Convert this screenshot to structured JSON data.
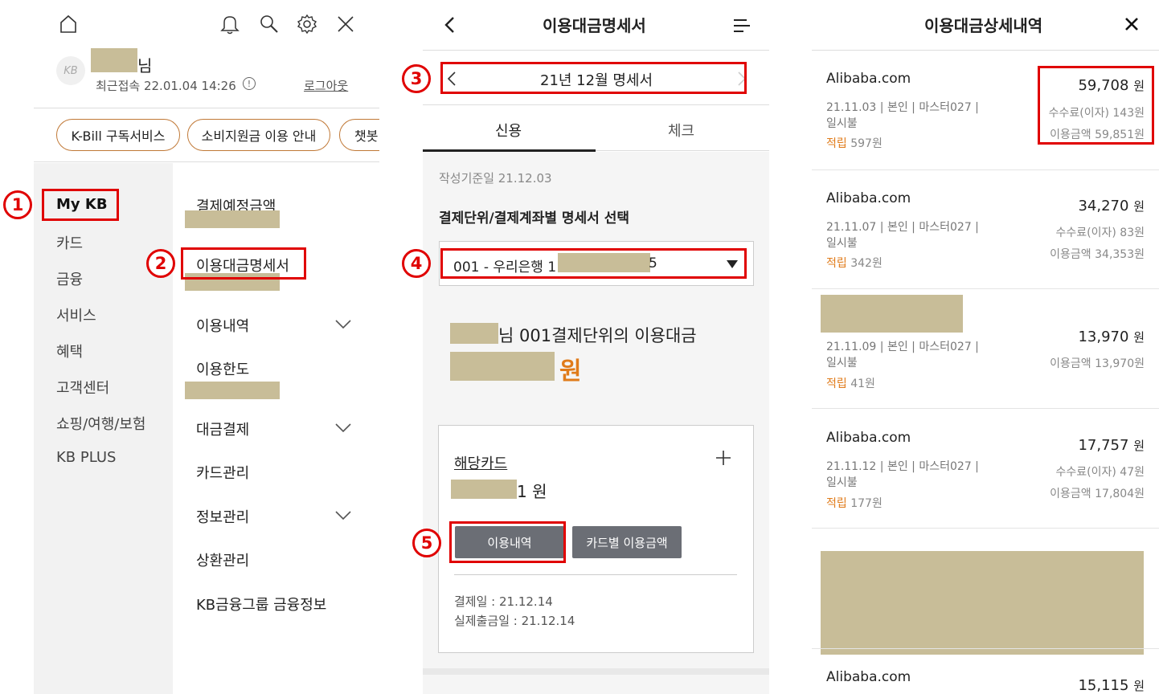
{
  "menu": {
    "user_suffix": "님",
    "last_login": "최근접속 22.01.04 14:26",
    "logout": "로그아웃",
    "chips": [
      "K-Bill 구독서비스",
      "소비지원금 이용 안내",
      "챗봇"
    ],
    "left_nav": [
      "My KB",
      "카드",
      "금융",
      "서비스",
      "혜택",
      "고객센터",
      "쇼핑/여행/보험",
      "KB PLUS"
    ],
    "sub_items": [
      "결제예정금액",
      "이용대금명세서",
      "이용내역",
      "이용한도",
      "대금결제",
      "카드관리",
      "정보관리",
      "상환관리",
      "KB금융그룹 금융정보"
    ],
    "logo_text": "KB"
  },
  "statement": {
    "title": "이용대금명세서",
    "month": "21년 12월 명세서",
    "tab_credit": "신용",
    "tab_check": "체크",
    "basis_date": "작성기준일 21.12.03",
    "select_label": "결제단위/결제계좌별 명세서 선택",
    "account_prefix": "001 - 우리은행 1",
    "account_suffix": "5",
    "billing_text": "님 001결제단위의 이용대금",
    "billing_won": "원",
    "card_link": "해당카드",
    "card_amount_suffix": "1 원",
    "btn_history": "이용내역",
    "btn_by_card": "카드별 이용금액",
    "pay_date": "결제일 : 21.12.14",
    "withdraw_date": "실제출금일 : 21.12.14"
  },
  "detail": {
    "title": "이용대금상세내역",
    "items": [
      {
        "merchant": "Alibaba.com",
        "date": "21.11.03",
        "owner": "본인",
        "card": "마스터027",
        "plan": "일시불",
        "points_label": "적립",
        "points": "597원",
        "amount": "59,708",
        "won": "원",
        "fee": "수수료(이자) 143원",
        "total": "이용금액 59,851원"
      },
      {
        "merchant": "Alibaba.com",
        "date": "21.11.07",
        "owner": "본인",
        "card": "마스터027",
        "plan": "일시불",
        "points_label": "적립",
        "points": "342원",
        "amount": "34,270",
        "won": "원",
        "fee": "수수료(이자) 83원",
        "total": "이용금액 34,353원"
      },
      {
        "merchant": "",
        "date": "21.11.09",
        "owner": "본인",
        "card": "마스터027",
        "plan": "일시불",
        "points_label": "적립",
        "points": "41원",
        "amount": "13,970",
        "won": "원",
        "fee": "",
        "total": "이용금액 13,970원"
      },
      {
        "merchant": "Alibaba.com",
        "date": "21.11.12",
        "owner": "본인",
        "card": "마스터027",
        "plan": "일시불",
        "points_label": "적립",
        "points": "177원",
        "amount": "17,757",
        "won": "원",
        "fee": "수수료(이자) 47원",
        "total": "이용금액 17,804원"
      },
      {
        "merchant": "Alibaba.com",
        "amount": "15,115",
        "won": "원"
      }
    ]
  },
  "markers": [
    "1",
    "2",
    "3",
    "4",
    "5"
  ],
  "colors": {
    "accent_orange": "#e07b1a",
    "chip_border": "#c07836",
    "annotation_red": "#e00000",
    "redaction": "#c8bd98",
    "button_grey": "#6b6e75"
  }
}
